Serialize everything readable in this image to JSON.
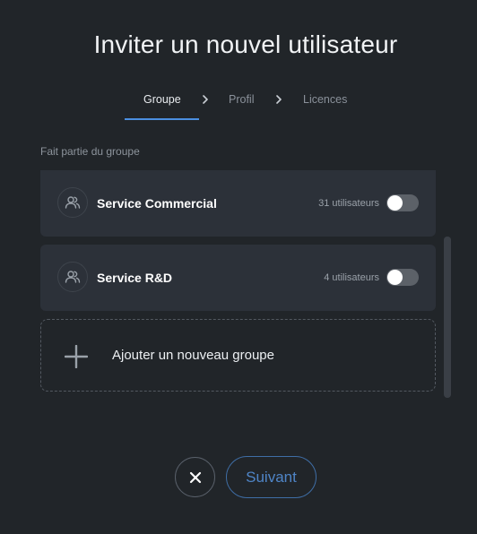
{
  "modal": {
    "title": "Inviter un nouvel utilisateur"
  },
  "steps": [
    {
      "label": "Groupe",
      "active": true
    },
    {
      "label": "Profil",
      "active": false
    },
    {
      "label": "Licences",
      "active": false
    }
  ],
  "section": {
    "label": "Fait partie du groupe"
  },
  "groups": [
    {
      "name": "Service Commercial",
      "count": "31 utilisateurs",
      "icon": "users-icon",
      "enabled": false
    },
    {
      "name": "Service R&D",
      "count": "4 utilisateurs",
      "icon": "users-icon",
      "enabled": false
    }
  ],
  "add_group": {
    "label": "Ajouter un nouveau groupe",
    "icon": "plus-icon"
  },
  "footer": {
    "close_icon": "close-icon",
    "next_label": "Suivant"
  },
  "colors": {
    "background": "#212529",
    "card": "#2c3139",
    "accent": "#4b8fe0",
    "next_text": "#4f85c7"
  }
}
